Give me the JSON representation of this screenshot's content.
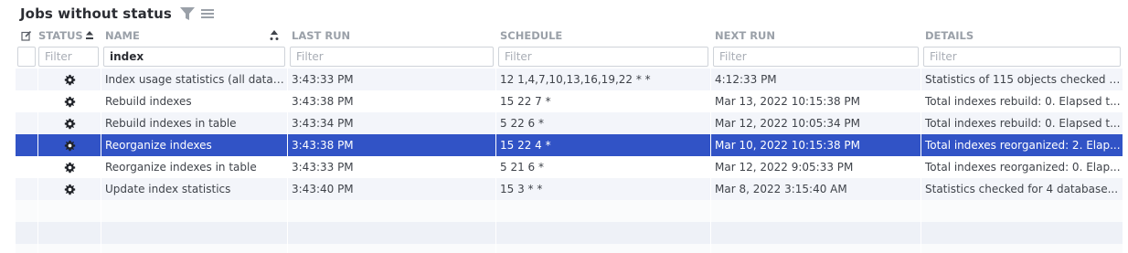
{
  "title": "Jobs without status",
  "columns": {
    "status": "STATUS",
    "name": "NAME",
    "last_run": "LAST RUN",
    "schedule": "SCHEDULE",
    "next_run": "NEXT RUN",
    "details": "DETAILS"
  },
  "filters": {
    "placeholder": "Filter",
    "name_value": "index"
  },
  "rows": [
    {
      "name": "Index usage statistics (all databases)",
      "last_run": "3:43:33 PM",
      "schedule": "12 1,4,7,10,13,16,19,22 * *",
      "next_run": "4:12:33 PM",
      "details": "Statistics of 115 objects checked (...",
      "status_icon": "gear-icon"
    },
    {
      "name": "Rebuild indexes",
      "last_run": "3:43:38 PM",
      "schedule": "15 22 7 *",
      "next_run": "Mar 13, 2022 10:15:38 PM",
      "details": "Total indexes rebuild: 0. Elapsed t...",
      "status_icon": "gear-icon"
    },
    {
      "name": "Rebuild indexes in table",
      "last_run": "3:43:34 PM",
      "schedule": "5 22 6 *",
      "next_run": "Mar 12, 2022 10:05:34 PM",
      "details": "Total indexes rebuild: 0. Elapsed t...",
      "status_icon": "gear-icon"
    },
    {
      "name": "Reorganize indexes",
      "last_run": "3:43:38 PM",
      "schedule": "15 22 4 *",
      "next_run": "Mar 10, 2022 10:15:38 PM",
      "details": "Total indexes reorganized: 2. Elap...",
      "status_icon": "gear-icon"
    },
    {
      "name": "Reorganize indexes in table",
      "last_run": "3:43:33 PM",
      "schedule": "5 21 6 *",
      "next_run": "Mar 12, 2022 9:05:33 PM",
      "details": "Total indexes reorganized: 0. Elap...",
      "status_icon": "gear-icon"
    },
    {
      "name": "Update index statistics",
      "last_run": "3:43:40 PM",
      "schedule": "15 3 * *",
      "next_run": "Mar 8, 2022 3:15:40 AM",
      "details": "Statistics checked for 4 database...",
      "status_icon": "gear-icon"
    }
  ],
  "colors": {
    "selected_row": "#3153c6",
    "alt_row": "#f3f5fa",
    "header_text": "#9aa0a8"
  }
}
